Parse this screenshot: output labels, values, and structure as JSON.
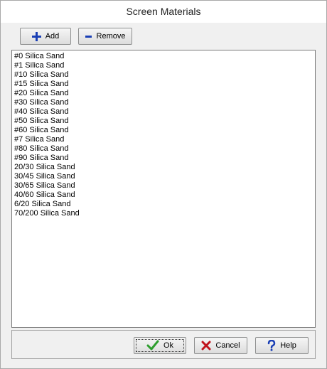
{
  "window": {
    "title": "Screen Materials"
  },
  "toolbar": {
    "add_label": "Add",
    "remove_label": "Remove"
  },
  "materials": [
    "#0 Silica Sand",
    "#1 Silica Sand",
    "#10 Silica Sand",
    "#15 Silica Sand",
    "#20 Silica Sand",
    "#30 Silica Sand",
    "#40 Silica Sand",
    "#50 Silica Sand",
    "#60 Silica Sand",
    "#7 Silica Sand",
    "#80 Silica Sand",
    "#90 Silica Sand",
    "20/30 Silica Sand",
    "30/45 Silica Sand",
    "30/65 Silica Sand",
    "40/60 Silica Sand",
    "6/20 Silica Sand",
    "70/200 Silica Sand"
  ],
  "footer": {
    "ok_label": "Ok",
    "cancel_label": "Cancel",
    "help_label": "Help"
  },
  "colors": {
    "accent_blue": "#1a3fb5",
    "ok_green": "#2e9e2e",
    "cancel_red": "#c0121b"
  },
  "icons": {
    "add": "plus-icon",
    "remove": "minus-icon",
    "ok": "check-icon",
    "cancel": "x-icon",
    "help": "question-icon"
  }
}
